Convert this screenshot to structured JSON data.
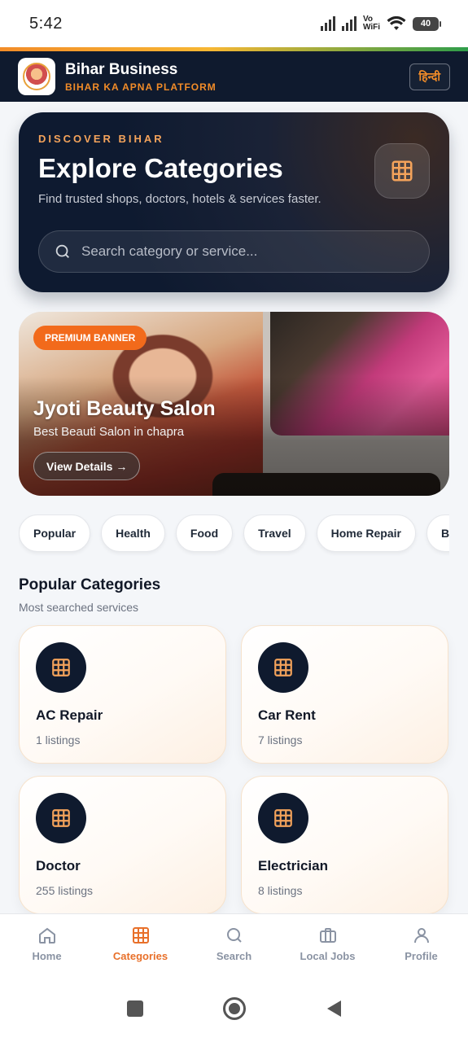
{
  "status_bar": {
    "time": "5:42",
    "network_top": "Vo",
    "network_bottom": "WiFi",
    "battery": "40"
  },
  "header": {
    "app_name": "Bihar Business",
    "tagline": "BIHAR KA APNA PLATFORM",
    "language_button": "हिन्दी"
  },
  "hero": {
    "eyebrow": "DISCOVER BIHAR",
    "title": "Explore Categories",
    "subtitle": "Find trusted shops, doctors, hotels & services faster.",
    "search_placeholder": "Search category or service..."
  },
  "banner": {
    "badge": "PREMIUM BANNER",
    "title": "Jyoti Beauty Salon",
    "subtitle": "Best Beauti Salon in chapra",
    "button": "View Details →"
  },
  "chips": [
    "Popular",
    "Health",
    "Food",
    "Travel",
    "Home Repair",
    "Beau"
  ],
  "popular": {
    "title": "Popular Categories",
    "subtitle": "Most searched services",
    "cards": [
      {
        "name": "AC Repair",
        "count": "1 listings"
      },
      {
        "name": "Car Rent",
        "count": "7 listings"
      },
      {
        "name": "Doctor",
        "count": "255 listings"
      },
      {
        "name": "Electrician",
        "count": "8 listings"
      }
    ]
  },
  "nav": {
    "items": [
      {
        "label": "Home",
        "icon": "home-icon"
      },
      {
        "label": "Categories",
        "icon": "grid-icon"
      },
      {
        "label": "Search",
        "icon": "search-icon"
      },
      {
        "label": "Local Jobs",
        "icon": "briefcase-icon"
      },
      {
        "label": "Profile",
        "icon": "user-icon"
      }
    ],
    "active": "Categories"
  },
  "colors": {
    "accent": "#e8702a",
    "navy": "#0f1a2e",
    "grid_icon": "#f4a35b"
  }
}
